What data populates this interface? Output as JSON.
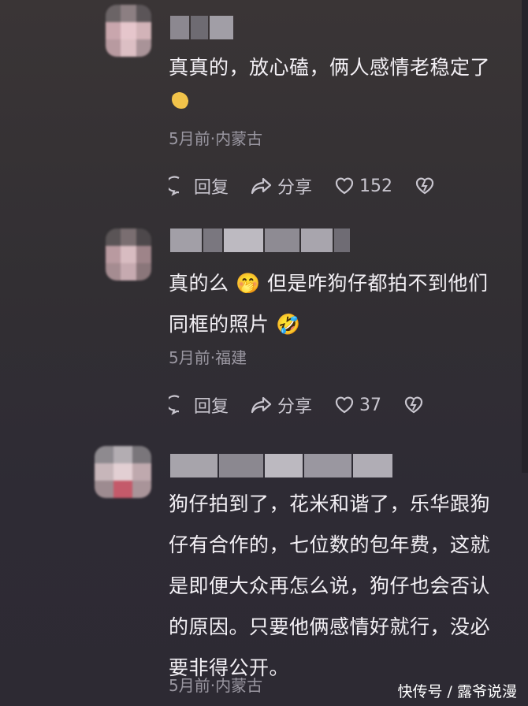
{
  "comments": [
    {
      "text": "真真的，放心磕，俩人感情老稳定了",
      "emoji_line": "🫰",
      "meta": "5月前·内蒙古",
      "reply_label": "回复",
      "share_label": "分享",
      "likes": "152"
    },
    {
      "text": "真的么 🤭 但是咋狗仔都拍不到他们同框的照片 🤣",
      "meta": "5月前·福建",
      "reply_label": "回复",
      "share_label": "分享",
      "likes": "37"
    },
    {
      "text": "狗仔拍到了，花米和谐了，乐华跟狗仔有合作的，七位数的包年费，这就是即便大众再怎么说，狗仔也会否认的原因。只要他俩感情好就行，没必要非得公开。",
      "meta": "5月前·内蒙古"
    }
  ],
  "watermark": "快传号 / 露爷说漫",
  "icons": [
    "reply-icon",
    "share-icon",
    "heart-icon",
    "dislike-icon"
  ],
  "colors": {
    "background": "#332f35",
    "text": "#f3f0f5",
    "meta": "#9a97a1"
  }
}
